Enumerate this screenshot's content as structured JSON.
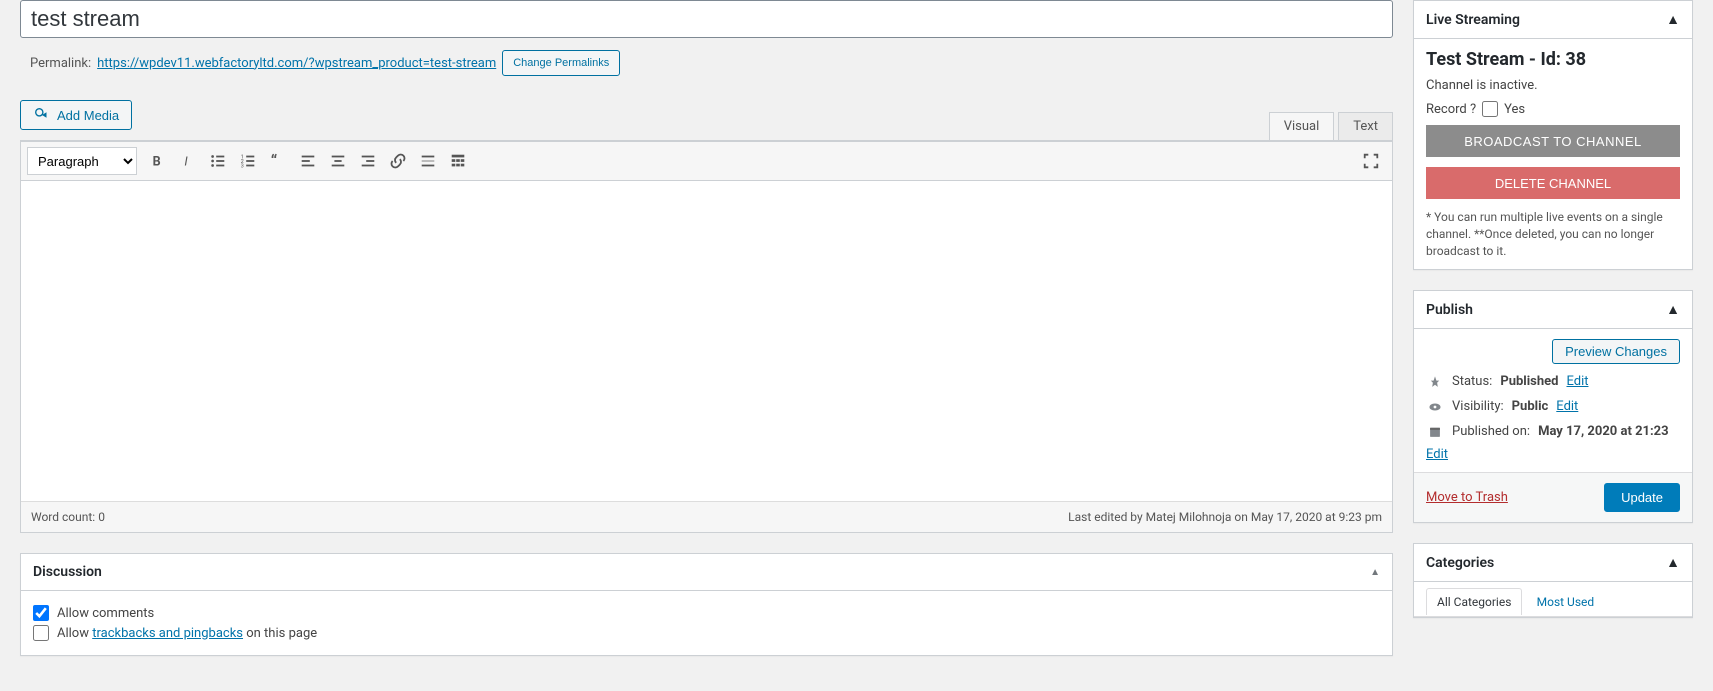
{
  "title": "test stream",
  "permalink": {
    "label": "Permalink:",
    "url": "https://wpdev11.webfactoryltd.com/?wpstream_product=test-stream",
    "change_label": "Change Permalinks"
  },
  "editor": {
    "add_media": "Add Media",
    "tabs": {
      "visual": "Visual",
      "text": "Text"
    },
    "paragraph": "Paragraph",
    "word_count_label": "Word count:",
    "word_count": "0",
    "last_edited": "Last edited by Matej Milohnoja on May 17, 2020 at 9:23 pm"
  },
  "discussion": {
    "title": "Discussion",
    "allow_comments": "Allow comments",
    "allow_trackbacks_pre": "Allow ",
    "allow_trackbacks_link": "trackbacks and pingbacks",
    "allow_trackbacks_post": " on this page"
  },
  "live": {
    "title": "Live Streaming",
    "stream_title": "Test Stream - Id: 38",
    "inactive": "Channel is inactive.",
    "record_label": "Record ?",
    "record_yes": "Yes",
    "broadcast": "BROADCAST TO CHANNEL",
    "delete": "DELETE CHANNEL",
    "note": "* You can run multiple live events on a single channel. **Once deleted, you can no longer broadcast to it."
  },
  "publish": {
    "title": "Publish",
    "preview": "Preview Changes",
    "status_label": "Status:",
    "status_value": "Published",
    "visibility_label": "Visibility:",
    "visibility_value": "Public",
    "published_label": "Published on:",
    "published_value": "May 17, 2020 at 21:23",
    "edit": "Edit",
    "trash": "Move to Trash",
    "update": "Update"
  },
  "categories": {
    "title": "Categories",
    "all": "All Categories",
    "most_used": "Most Used"
  }
}
